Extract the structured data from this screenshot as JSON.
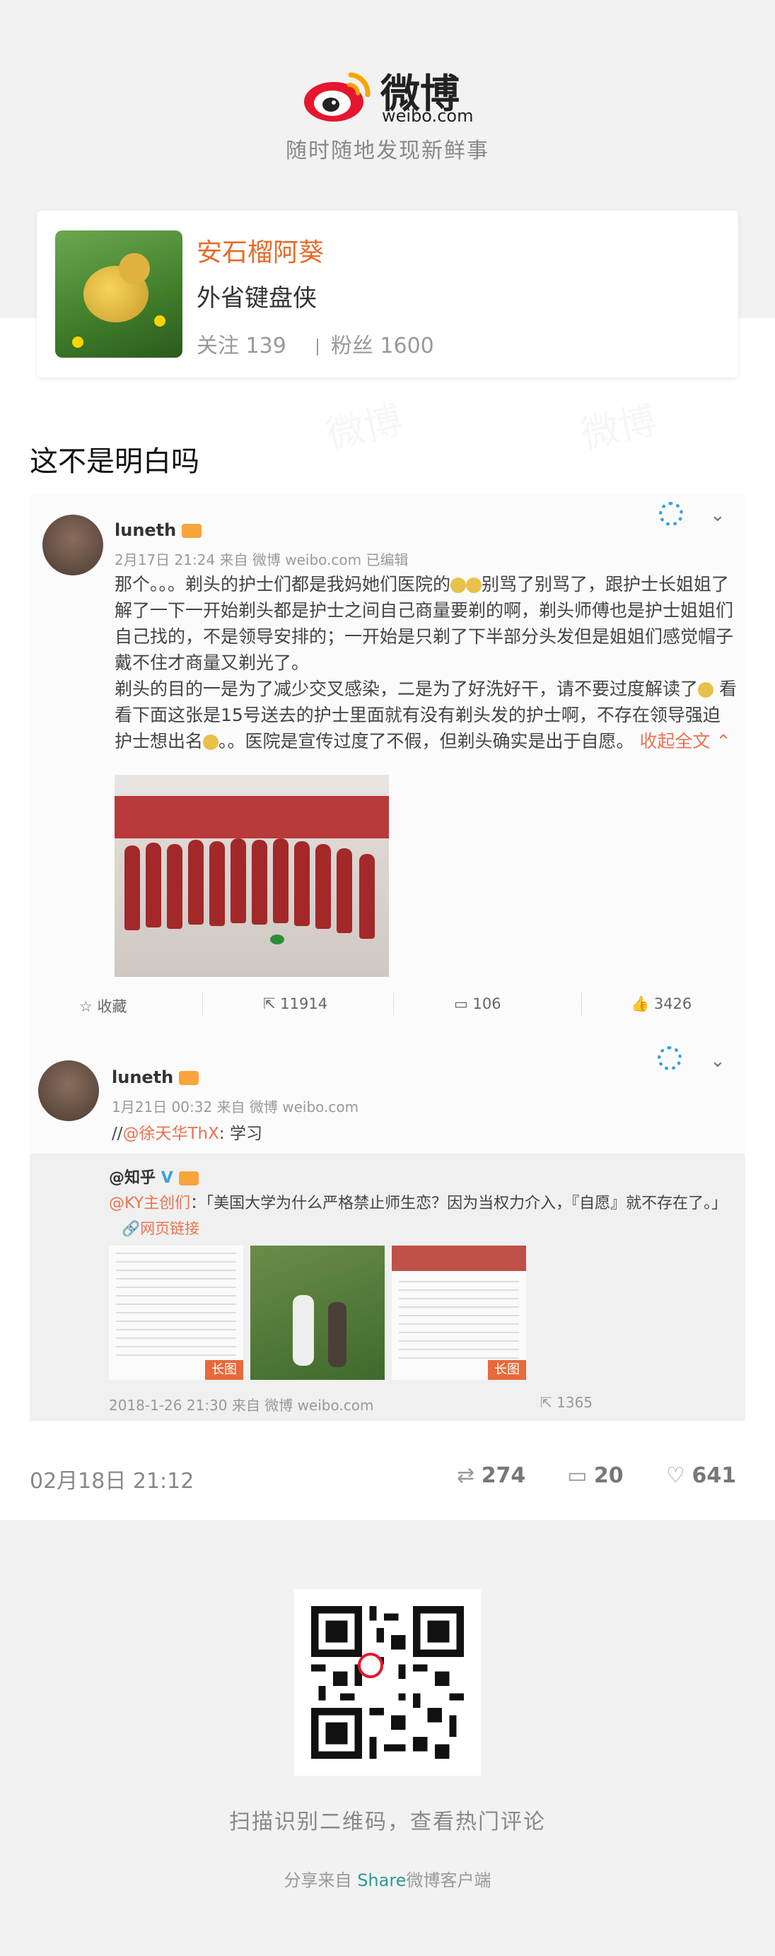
{
  "brand": {
    "logo_text": "微博",
    "logo_sub": "weibo.com",
    "tagline": "随时随地发现新鲜事"
  },
  "profile": {
    "name": "安石榴阿葵",
    "description": "外省键盘侠",
    "following_label": "关注 139",
    "followers_label": "粉丝 1600"
  },
  "post": {
    "text": "这不是明白吗",
    "time": "02月18日 21:12",
    "reposts": "274",
    "comments": "20",
    "likes": "641"
  },
  "screenshot": {
    "author": "luneth",
    "meta": "2月17日 21:24 来自 微博 weibo.com  已编辑",
    "body_1": "那个。。。剃头的护士们都是我妈她们医院的",
    "body_2": "别骂了别骂了，跟护士长姐姐了解了一下一开始剃头都是护士之间自己商量要剃的啊，剃头师傅也是护士姐姐们自己找的，不是领导安排的；一开始是只剃了下半部分头发但是姐姐们感觉帽子戴不住才商量又剃光了。",
    "body_3": "剃头的目的一是为了减少交叉感染，二是为了好洗好干，请不要过度解读了",
    "body_4": "看看下面这张是15号送去的护士里面就有没有剃头发的护士啊，不存在领导强迫护士想出名",
    "body_5": "。。医院是宣传过度了不假，但剃头确实是出于自愿。",
    "collapse_label": "收起全文",
    "action_fav": "☆ 收藏",
    "action_share": "11914",
    "action_comment": "106",
    "action_like": "3426"
  },
  "repost": {
    "author": "luneth",
    "meta": "1月21日 00:32 来自 微博 weibo.com",
    "text_prefix": "//",
    "mention": "@徐天华ThX",
    "text_suffix": ": 学习",
    "quote_author": "@知乎",
    "quote_mention": "@KY主创们",
    "quote_text": "：「美国大学为什么严格禁止师生恋？因为当权力介入，『自愿』就不存在了。」",
    "quote_link": "网页链接",
    "image_tag": "长图",
    "quote_time": "2018-1-26 21:30 来自 微博 weibo.com",
    "quote_share": "1365"
  },
  "footer": {
    "qr_caption": "扫描识别二维码，查看热门评论",
    "share_prefix": "分享来自 ",
    "share_app": "Share",
    "share_suffix": "微博客户端"
  },
  "colors": {
    "accent_orange": "#e86b28",
    "weibo_red": "#e6162d",
    "share_green": "#2d9a8f"
  }
}
